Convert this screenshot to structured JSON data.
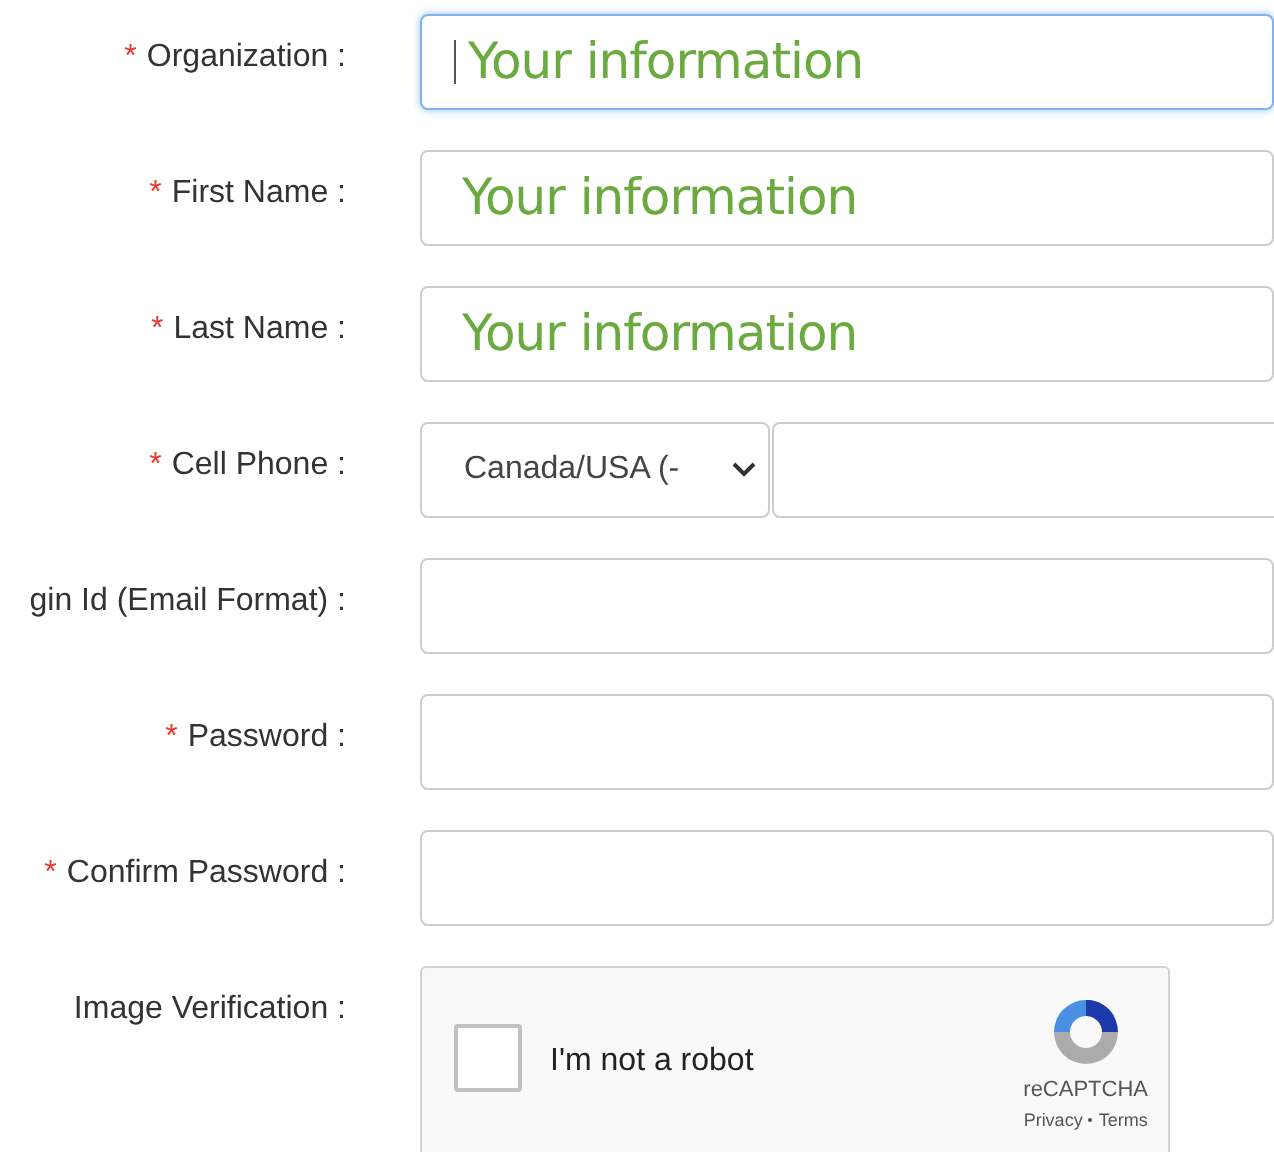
{
  "fields": [
    {
      "kind": "text",
      "required_mark": "*",
      "label": "Organization :",
      "value": "Your information",
      "focused": true
    },
    {
      "kind": "text",
      "required_mark": "*",
      "label": "First Name :",
      "value": "Your information",
      "focused": false
    },
    {
      "kind": "text",
      "required_mark": "*",
      "label": "Last Name :",
      "value": "Your information",
      "focused": false
    },
    {
      "kind": "phone",
      "required_mark": "*",
      "label": "Cell Phone :",
      "country": "Canada/USA (-"
    },
    {
      "kind": "text",
      "label": "gin Id (Email Format) :",
      "focused": false
    },
    {
      "kind": "text",
      "required_mark": "*",
      "label": "Password :",
      "focused": false
    },
    {
      "kind": "text",
      "required_mark": "*",
      "label": "Confirm Password :",
      "focused": false
    },
    {
      "kind": "captcha",
      "label": "Image Verification :",
      "checkbox_label": "I'm not a robot",
      "checked": false,
      "brand": "reCAPTCHA",
      "links": [
        "Privacy",
        "Terms"
      ]
    }
  ]
}
